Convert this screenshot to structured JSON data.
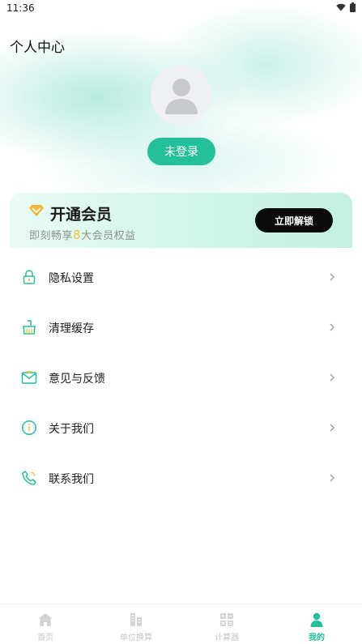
{
  "status": {
    "time": "11:36",
    "icons": [
      "wifi-icon",
      "battery-icon"
    ]
  },
  "page": {
    "title": "个人中心"
  },
  "profile": {
    "avatar_icon": "user-avatar-icon",
    "login_label": "未登录"
  },
  "vip": {
    "icon": "diamond-icon",
    "title": "开通会员",
    "subtitle_prefix": "即刻畅享",
    "benefit_count": "8",
    "subtitle_suffix": "大会员权益",
    "button_label": "立即解锁"
  },
  "menu": [
    {
      "label": "隐私设置",
      "icon": "lock-icon"
    },
    {
      "label": "清理缓存",
      "icon": "broom-icon"
    },
    {
      "label": "意见与反馈",
      "icon": "feedback-mail-icon"
    },
    {
      "label": "关于我们",
      "icon": "info-icon"
    },
    {
      "label": "联系我们",
      "icon": "phone-icon"
    }
  ],
  "tabs": [
    {
      "label": "首页",
      "icon": "home-icon",
      "active": false
    },
    {
      "label": "单位换算",
      "icon": "unit-convert-icon",
      "active": false
    },
    {
      "label": "计算器",
      "icon": "calculator-icon",
      "active": false
    },
    {
      "label": "我的",
      "icon": "person-icon",
      "active": true
    }
  ],
  "colors": {
    "accent": "#23c09a",
    "vip_number": "#f0c53a",
    "unlock_button": "#0b0b0b"
  }
}
